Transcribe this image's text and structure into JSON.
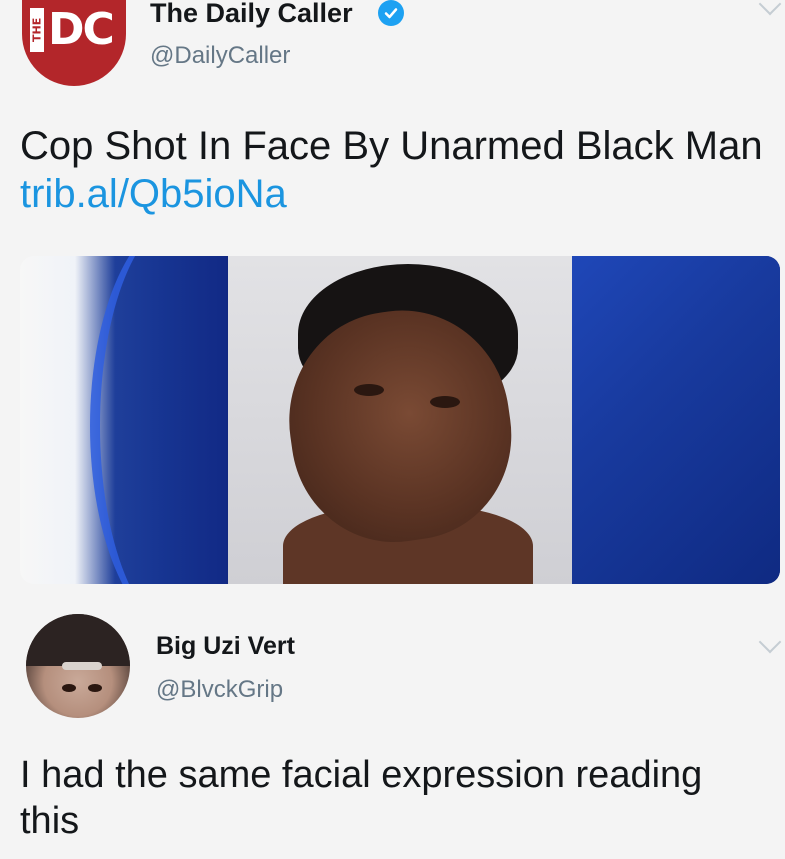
{
  "tweet_top": {
    "author_name": "The Daily Caller",
    "verified": true,
    "handle": "@DailyCaller",
    "avatar_text_vertical": "THE",
    "avatar_text": "DC",
    "text": "Cop Shot In Face By Unarmed Black Man",
    "link": "trib.al/Qb5ioNa",
    "accent_color": "#1b95e0",
    "brand_color": "#b3262a"
  },
  "tweet_reply": {
    "author_name": "Big Uzi Vert",
    "handle": "@BlvckGrip",
    "text": "I had the same facial expression reading this"
  }
}
